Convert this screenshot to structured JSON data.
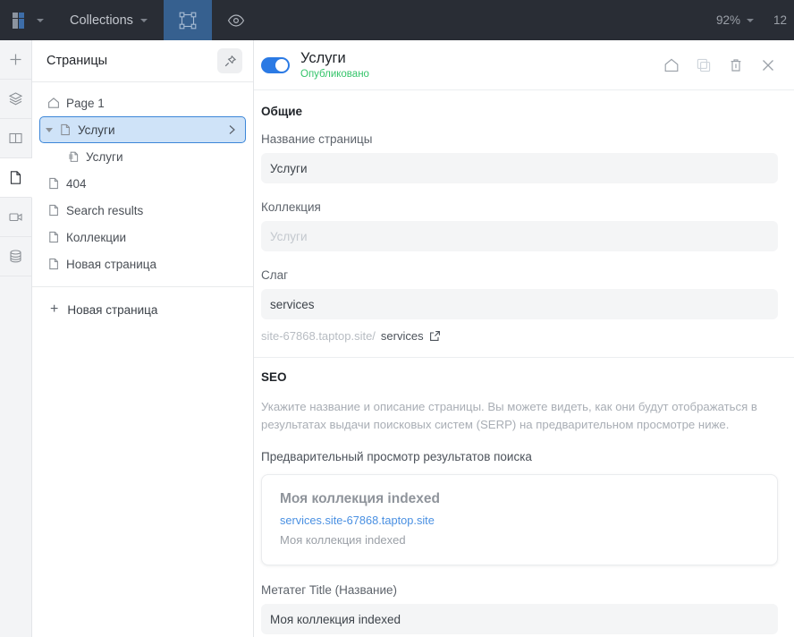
{
  "topbar": {
    "collections_label": "Collections",
    "zoom_label": "92%",
    "right_cut_label": "12",
    "icons": [
      "logo",
      "chevron-down",
      "chevron-down",
      "frame-select",
      "eye-preview"
    ]
  },
  "rail": {
    "items": [
      {
        "name": "add",
        "icon": "plus-icon",
        "active": false
      },
      {
        "name": "layers",
        "icon": "layers-icon",
        "active": false
      },
      {
        "name": "library",
        "icon": "book-icon",
        "active": false
      },
      {
        "name": "pages",
        "icon": "page-icon",
        "active": true
      },
      {
        "name": "media",
        "icon": "video-icon",
        "active": false
      },
      {
        "name": "database",
        "icon": "database-icon",
        "active": false
      }
    ]
  },
  "pages_panel": {
    "title": "Страницы",
    "pin_icon": "pin-icon",
    "items": [
      {
        "label": "Page 1",
        "icon": "home-icon",
        "selected": false,
        "indent": false,
        "expandable": false
      },
      {
        "label": "Услуги",
        "icon": "page-icon",
        "selected": true,
        "indent": false,
        "expandable": true
      },
      {
        "label": "Услуги",
        "icon": "collection-page-icon",
        "selected": false,
        "indent": true,
        "expandable": false
      },
      {
        "label": "404",
        "icon": "page-icon",
        "selected": false,
        "indent": false,
        "expandable": false
      },
      {
        "label": "Search results",
        "icon": "page-icon",
        "selected": false,
        "indent": false,
        "expandable": false
      },
      {
        "label": "Коллекции",
        "icon": "page-icon",
        "selected": false,
        "indent": false,
        "expandable": false
      },
      {
        "label": "Новая страница",
        "icon": "page-icon",
        "selected": false,
        "indent": false,
        "expandable": false
      }
    ],
    "new_page_label": "Новая страница"
  },
  "detail": {
    "toggle_on": true,
    "title": "Услуги",
    "status": "Опубликовано",
    "actions": [
      {
        "name": "set-home-button",
        "icon": "home-icon",
        "disabled": false
      },
      {
        "name": "duplicate-button",
        "icon": "duplicate-icon",
        "disabled": true
      },
      {
        "name": "delete-button",
        "icon": "trash-icon",
        "disabled": false
      },
      {
        "name": "close-button",
        "icon": "close-icon",
        "disabled": false
      }
    ],
    "general": {
      "section_title": "Общие",
      "page_name_label": "Название страницы",
      "page_name_value": "Услуги",
      "collection_label": "Коллекция",
      "collection_value": "Услуги",
      "slug_label": "Слаг",
      "slug_value": "services",
      "url_prefix": "site-67868.taptop.site/",
      "url_slug": "services",
      "external_link_icon": "external-link-icon"
    },
    "seo": {
      "section_title": "SEO",
      "help_text": "Укажите название и описание страницы. Вы можете видеть, как они будут отображаться в результатах выдачи поисковых систем (SERP) на предварительном просмотре ниже.",
      "preview_label": "Предварительный просмотр результатов поиска",
      "serp": {
        "title": "Моя коллекция indexed",
        "url": "services.site-67868.taptop.site",
        "description": "Моя коллекция indexed"
      },
      "meta_title_label": "Метатег Title (Название)",
      "meta_title_value": "Моя коллекция indexed"
    }
  },
  "colors": {
    "topbar_bg": "#292d35",
    "accent_blue": "#2b7ae4",
    "active_tool_blue": "#36608f",
    "published_green": "#35c46a",
    "selected_row_bg": "#cfe3f8",
    "selected_row_border": "#3c86d8",
    "link_blue": "#4a90e2"
  }
}
